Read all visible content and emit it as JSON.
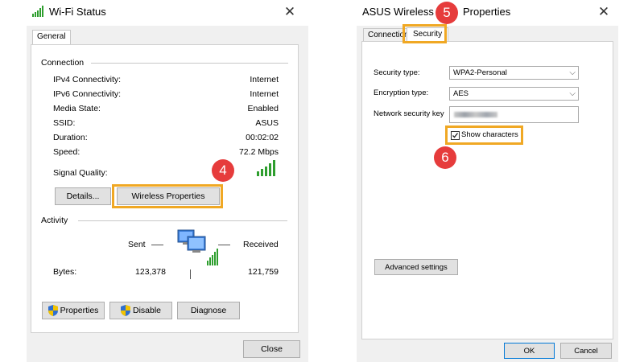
{
  "wifi_status": {
    "title": "Wi-Fi Status",
    "tab_general": "General",
    "connection_heading": "Connection",
    "rows": [
      {
        "label": "IPv4 Connectivity:",
        "value": "Internet"
      },
      {
        "label": "IPv6 Connectivity:",
        "value": "Internet"
      },
      {
        "label": "Media State:",
        "value": "Enabled"
      },
      {
        "label": "SSID:",
        "value": "ASUS"
      },
      {
        "label": "Duration:",
        "value": "00:02:02"
      },
      {
        "label": "Speed:",
        "value": "72.2 Mbps"
      }
    ],
    "signal_quality_label": "Signal Quality:",
    "details_button": "Details...",
    "wireless_properties_button": "Wireless Properties",
    "activity_heading": "Activity",
    "sent_label": "Sent",
    "received_label": "Received",
    "bytes_label": "Bytes:",
    "bytes_sent": "123,378",
    "bytes_received": "121,759",
    "properties_button": "Properties",
    "disable_button": "Disable",
    "diagnose_button": "Diagnose",
    "close_button": "Close"
  },
  "wireless_props": {
    "title_left": "ASUS Wireless Net",
    "title_right": "Properties",
    "tab_connection": "Connection",
    "tab_security": "Security",
    "security_type_label": "Security type:",
    "security_type_value": "WPA2-Personal",
    "encryption_type_label": "Encryption type:",
    "encryption_type_value": "AES",
    "network_key_label": "Network security key",
    "show_characters_label": "Show characters",
    "show_characters_checked": true,
    "advanced_settings_button": "Advanced settings",
    "ok_button": "OK",
    "cancel_button": "Cancel"
  },
  "badges": {
    "step4": "4",
    "step5": "5",
    "step6": "6"
  },
  "colors": {
    "highlight": "#f0a824",
    "badge": "#e63c3c",
    "signal": "#2e9e2e"
  },
  "icons": {
    "close": "close-icon",
    "signal": "signal-bars-icon",
    "network": "network-computers-icon",
    "shield": "uac-shield-icon",
    "dropdown": "chevron-down-icon",
    "check": "checkmark-icon"
  }
}
